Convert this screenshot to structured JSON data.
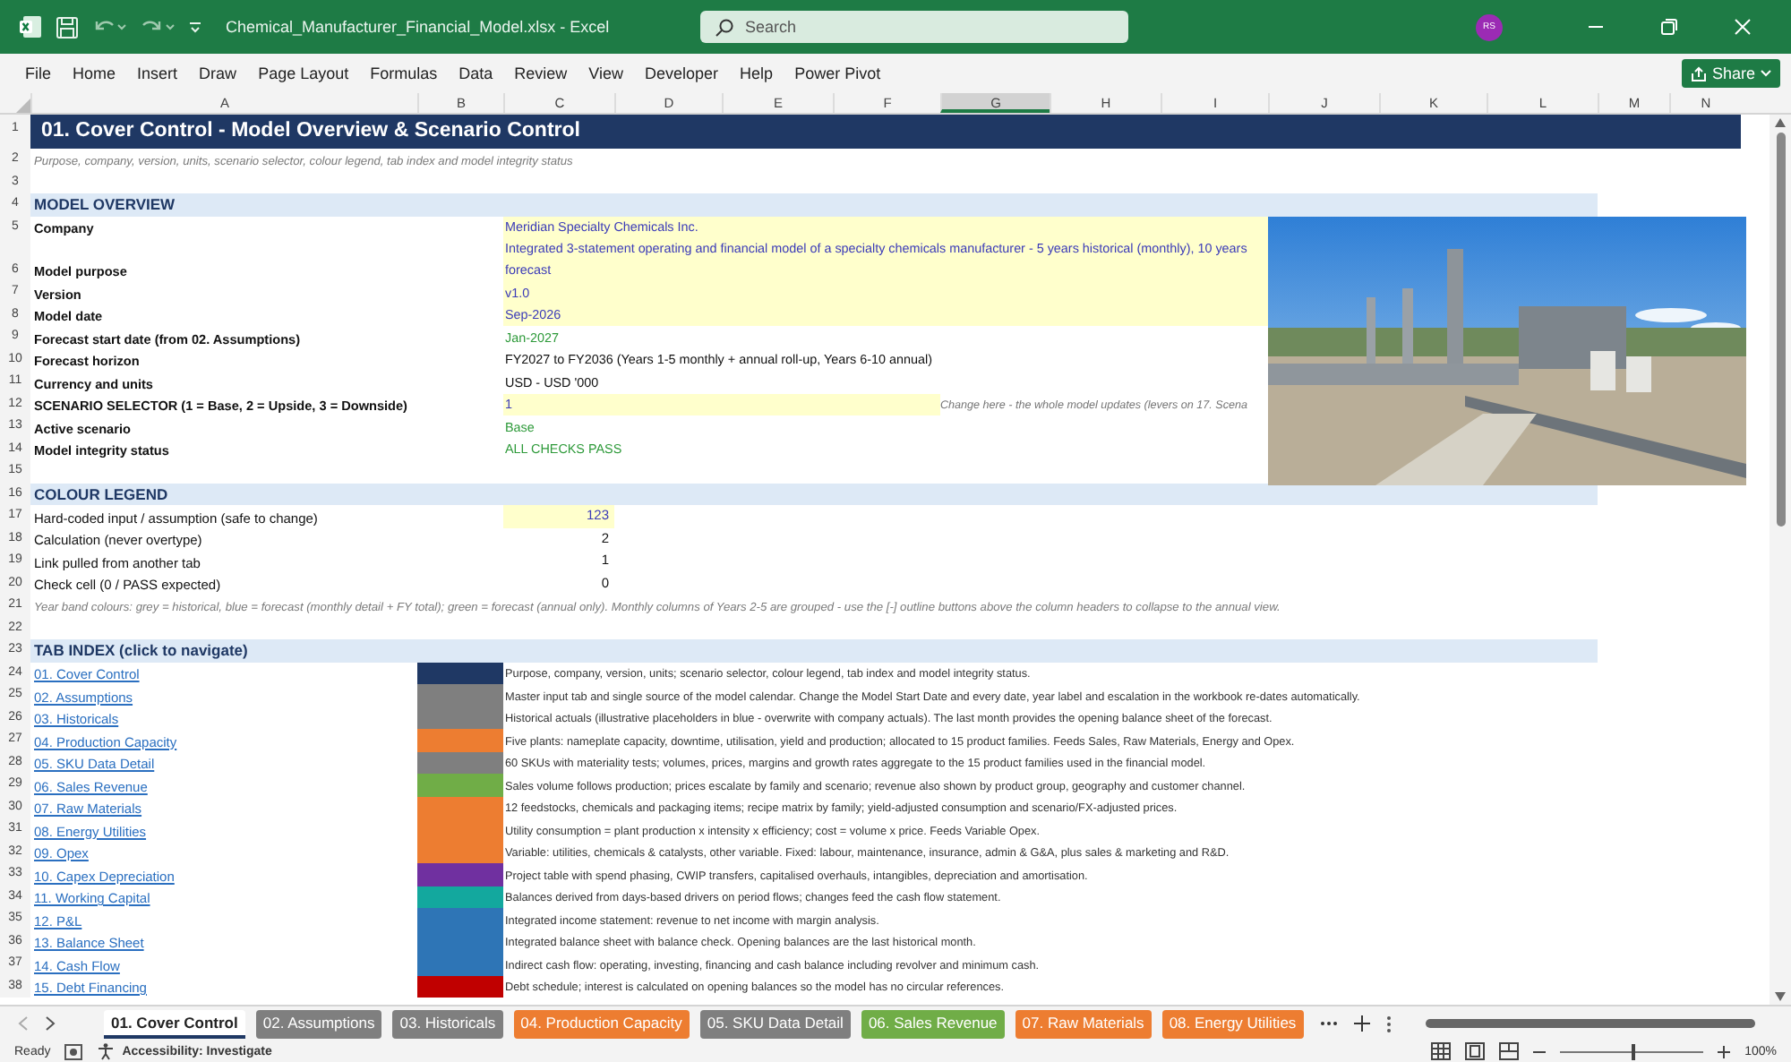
{
  "window": {
    "title": "Chemical_Manufacturer_Financial_Model.xlsx  -  Excel",
    "search_placeholder": "Search",
    "avatar": "RS"
  },
  "menu": [
    "File",
    "Home",
    "Insert",
    "Draw",
    "Page Layout",
    "Formulas",
    "Data",
    "Review",
    "View",
    "Developer",
    "Help",
    "Power Pivot"
  ],
  "share": "Share",
  "columns": [
    {
      "label": "A",
      "selected": false
    },
    {
      "label": "B",
      "selected": false
    },
    {
      "label": "C",
      "selected": false
    },
    {
      "label": "D",
      "selected": false
    },
    {
      "label": "E",
      "selected": false
    },
    {
      "label": "F",
      "selected": false
    },
    {
      "label": "G",
      "selected": true
    },
    {
      "label": "H",
      "selected": false
    },
    {
      "label": "I",
      "selected": false
    },
    {
      "label": "J",
      "selected": false
    },
    {
      "label": "K",
      "selected": false
    },
    {
      "label": "L",
      "selected": false
    },
    {
      "label": "M",
      "selected": false
    },
    {
      "label": "N",
      "selected": false
    }
  ],
  "rows": [
    {
      "num": "1",
      "kind": "title",
      "text": "01. Cover Control - Model Overview & Scenario Control"
    },
    {
      "num": "2",
      "kind": "note",
      "text": "Purpose, company, version, units, scenario selector, colour legend, tab index and model integrity status"
    },
    {
      "num": "3",
      "kind": "blank"
    },
    {
      "num": "4",
      "kind": "section",
      "text": "MODEL OVERVIEW"
    },
    {
      "num": "5",
      "kind": "input_field",
      "label": "Company",
      "value": "Meridian Specialty Chemicals Inc."
    },
    {
      "num": "6",
      "kind": "input_field",
      "label": "Model purpose",
      "value": "Integrated 3-statement operating and financial model of a specialty chemicals manufacturer - 5 years historical (monthly), 10 years forecast"
    },
    {
      "num": "7",
      "kind": "input_field",
      "label": "Version",
      "value": "v1.0"
    },
    {
      "num": "8",
      "kind": "input_field",
      "label": "Model date",
      "value": "Sep-2026"
    },
    {
      "num": "9",
      "kind": "link_field",
      "label": "Forecast start date (from 02. Assumptions)",
      "value": "Jan-2027"
    },
    {
      "num": "10",
      "kind": "calc_field",
      "label": "Forecast horizon",
      "value": "FY2027 to FY2036  (Years 1-5 monthly + annual roll-up, Years 6-10 annual)"
    },
    {
      "num": "11",
      "kind": "calc_field",
      "label": "Currency and units",
      "value": "USD - USD '000"
    },
    {
      "num": "12",
      "kind": "input_field",
      "label": "SCENARIO SELECTOR (1 = Base, 2 = Upside, 3 = Downside)",
      "value": "1",
      "note": "Change here - the whole model updates (levers on 17. Scena"
    },
    {
      "num": "13",
      "kind": "link_field",
      "label": "Active scenario",
      "value": "Base"
    },
    {
      "num": "14",
      "kind": "link_field",
      "label": "Model integrity status",
      "value": "ALL CHECKS PASS"
    },
    {
      "num": "15",
      "kind": "blank"
    },
    {
      "num": "16",
      "kind": "section",
      "text": "COLOUR LEGEND"
    },
    {
      "num": "17",
      "kind": "input_legend",
      "label": "Hard-coded input / assumption (safe to change)",
      "value": "123"
    },
    {
      "num": "18",
      "kind": "calc_legend",
      "label": "Calculation (never overtype)",
      "value": "2"
    },
    {
      "num": "19",
      "kind": "calc_legend",
      "label": "Link pulled from another tab",
      "value": "1"
    },
    {
      "num": "20",
      "kind": "calc_legend",
      "label": "Check cell (0 / PASS expected)",
      "value": "0"
    },
    {
      "num": "21",
      "kind": "note",
      "text": "Year band colours: grey = historical, blue = forecast (monthly detail + FY total); green = forecast (annual only). Monthly columns of Years 2-5 are grouped - use the [-] outline buttons above the column headers to collapse to the annual view."
    },
    {
      "num": "22",
      "kind": "blank"
    },
    {
      "num": "23",
      "kind": "section",
      "text": "TAB INDEX (click to navigate)"
    },
    {
      "num": "24",
      "kind": "tablink",
      "link": "01. Cover Control",
      "color": "#1f3864",
      "text": "Purpose, company, version, units; scenario selector, colour legend, tab index and model integrity status."
    },
    {
      "num": "25",
      "kind": "tablink",
      "link": "02. Assumptions",
      "color": "#7f7f7f",
      "text": "Master input tab and single source of the model calendar. Change the Model Start Date and every date, year label and escalation in the workbook re-dates automatically."
    },
    {
      "num": "26",
      "kind": "tablink",
      "link": "03. Historicals",
      "color": "#7f7f7f",
      "text": "Historical actuals (illustrative placeholders in blue - overwrite with company actuals). The last month provides the opening balance sheet of the forecast."
    },
    {
      "num": "27",
      "kind": "tablink",
      "link": "04. Production Capacity",
      "color": "#ed7d31",
      "text": "Five plants: nameplate capacity, downtime, utilisation, yield and production; allocated to 15 product families. Feeds Sales, Raw Materials, Energy and Opex."
    },
    {
      "num": "28",
      "kind": "tablink",
      "link": "05. SKU Data Detail",
      "color": "#7f7f7f",
      "text": "60 SKUs with materiality tests; volumes, prices, margins and growth rates aggregate to the 15 product families used in the financial model."
    },
    {
      "num": "29",
      "kind": "tablink",
      "link": "06. Sales Revenue",
      "color": "#70ad47",
      "text": "Sales volume follows production; prices escalate by family and scenario; revenue also shown by product group, geography and customer channel."
    },
    {
      "num": "30",
      "kind": "tablink",
      "link": "07. Raw Materials",
      "color": "#ed7d31",
      "text": "12 feedstocks, chemicals and packaging items; recipe matrix by family; yield-adjusted consumption and scenario/FX-adjusted prices."
    },
    {
      "num": "31",
      "kind": "tablink",
      "link": "08. Energy Utilities",
      "color": "#ed7d31",
      "text": "Utility consumption = plant production x intensity x efficiency; cost = volume x price. Feeds Variable Opex."
    },
    {
      "num": "32",
      "kind": "tablink",
      "link": "09. Opex",
      "color": "#ed7d31",
      "text": "Variable: utilities, chemicals & catalysts, other variable. Fixed: labour, maintenance, insurance, admin & G&A, plus sales & marketing and R&D."
    },
    {
      "num": "33",
      "kind": "tablink",
      "link": "10. Capex Depreciation",
      "color": "#7030a0",
      "text": "Project table with spend phasing, CWIP transfers, capitalised overhauls, intangibles, depreciation and amortisation."
    },
    {
      "num": "34",
      "kind": "tablink",
      "link": "11. Working Capital",
      "color": "#13a89e",
      "text": "Balances derived from days-based drivers on period flows; changes feed the cash flow statement."
    },
    {
      "num": "35",
      "kind": "tablink",
      "link": "12. P&L",
      "color": "#2e75b6",
      "text": "Integrated income statement: revenue to net income with margin analysis."
    },
    {
      "num": "36",
      "kind": "tablink",
      "link": "13. Balance Sheet",
      "color": "#2e75b6",
      "text": "Integrated balance sheet with balance check. Opening balances are the last historical month."
    },
    {
      "num": "37",
      "kind": "tablink",
      "link": "14. Cash Flow",
      "color": "#2e75b6",
      "text": "Indirect cash flow: operating, investing, financing and cash balance including revolver and minimum cash."
    },
    {
      "num": "38",
      "kind": "tablink",
      "link": "15. Debt Financing",
      "color": "#c00000",
      "text": "Debt schedule; interest is calculated on opening balances so the model has no circular references."
    }
  ],
  "sheet_tabs": [
    {
      "label": "01. Cover Control",
      "color": "#1f3864",
      "selected": true
    },
    {
      "label": "02. Assumptions",
      "color": "#7f7f7f",
      "selected": false
    },
    {
      "label": "03. Historicals",
      "color": "#7f7f7f",
      "selected": false
    },
    {
      "label": "04. Production Capacity",
      "color": "#ed7d31",
      "selected": false
    },
    {
      "label": "05. SKU Data Detail",
      "color": "#7f7f7f",
      "selected": false
    },
    {
      "label": "06. Sales Revenue",
      "color": "#70ad47",
      "selected": false
    },
    {
      "label": "07. Raw Materials",
      "color": "#ed7d31",
      "selected": false
    },
    {
      "label": "08. Energy Utilities",
      "color": "#ed7d31",
      "selected": false
    }
  ],
  "status_bar": {
    "ready": "Ready",
    "accessibility": "Accessibility: Investigate",
    "zoom": "100%",
    "zoom_slider": {
      "level": 0.5
    }
  }
}
